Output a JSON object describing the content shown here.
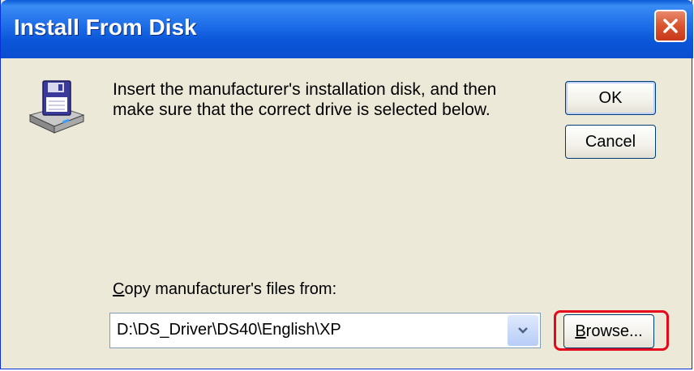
{
  "window": {
    "title": "Install From Disk"
  },
  "message": {
    "line1": "Insert the manufacturer's installation disk, and then",
    "line2": "make sure that the correct drive is selected below."
  },
  "buttons": {
    "ok": "OK",
    "cancel": "Cancel",
    "browse_mnemonic": "B",
    "browse_rest": "rowse..."
  },
  "copy_from": {
    "label_mnemonic": "C",
    "label_rest": "opy manufacturer's files from:",
    "value": "D:\\DS_Driver\\DS40\\English\\XP"
  },
  "icons": {
    "disk": "floppy-disk-drive-icon",
    "close": "close-icon",
    "dropdown": "chevron-down-icon"
  },
  "colors": {
    "titlebar": "#0a56d8",
    "highlight": "#e5091b",
    "dialog_bg": "#ece9d8"
  }
}
